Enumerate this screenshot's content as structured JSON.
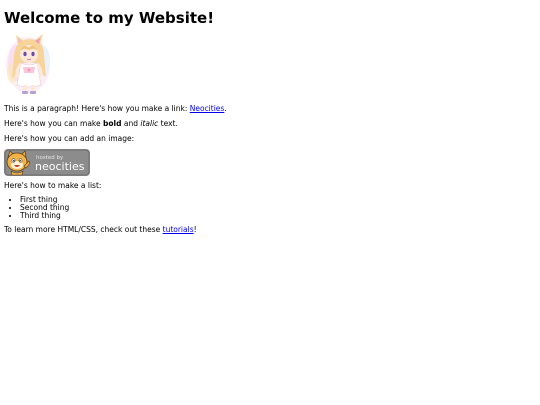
{
  "title": "Welcome to my Website!",
  "avatar": {
    "alt": "anime girl with cat ears"
  },
  "paragraph_link": {
    "prefix": "This is a paragraph! Here's how you make a link: ",
    "link_text": "Neocities",
    "suffix": "."
  },
  "paragraph_format": {
    "prefix": "Here's how you can make ",
    "bold": "bold",
    "middle": " and ",
    "italic": "italic",
    "suffix": " text."
  },
  "paragraph_image": "Here's how you can add an image:",
  "badge": {
    "small_text": "hosted by",
    "brand": "neocities",
    "bg": "#8c8c8c"
  },
  "paragraph_list": "Here's how to make a list:",
  "list_items": [
    "First thing",
    "Second thing",
    "Third thing"
  ],
  "paragraph_learn": {
    "prefix": "To learn more HTML/CSS, check out these ",
    "link_text": "tutorials",
    "suffix": "!"
  },
  "colors": {
    "link": "#0000ee",
    "text": "#000000",
    "background": "#ffffff"
  }
}
